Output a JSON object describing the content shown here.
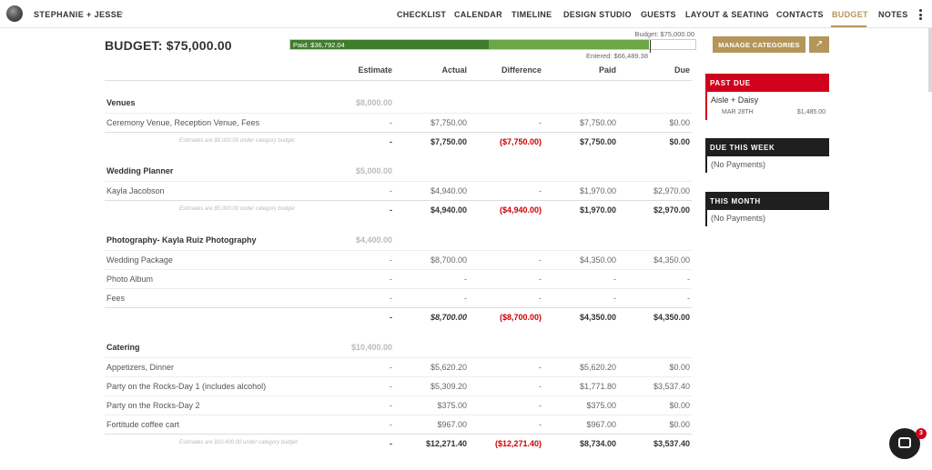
{
  "header": {
    "couple_name": "STEPHANIE + JESSE",
    "nav": [
      {
        "label": "CHECKLIST"
      },
      {
        "label": "CALENDAR"
      },
      {
        "label": "TIMELINE"
      },
      {
        "label": "DESIGN STUDIO"
      },
      {
        "label": "GUESTS"
      },
      {
        "label": "LAYOUT & SEATING"
      },
      {
        "label": "CONTACTS"
      },
      {
        "label": "BUDGET"
      },
      {
        "label": "NOTES"
      }
    ],
    "active_nav": "BUDGET",
    "accent_color": "#b4965a"
  },
  "budget": {
    "title": "BUDGET:",
    "amount": "$75,000.00",
    "bar_budget_label": "Budget: $75,000.00",
    "bar_paid_label": "Paid: $36,792.04",
    "bar_entered_label": "Entered: $66,489.38",
    "paid_fraction": 0.4906,
    "entered_fraction": 0.8865,
    "paid_color": "#3f7d2a",
    "entered_color": "#6ca647"
  },
  "toolbar": {
    "manage_label": "MANAGE CATEGORIES",
    "export_icon": "export-icon"
  },
  "table": {
    "columns": [
      "Estimate",
      "Actual",
      "Difference",
      "Paid",
      "Due"
    ],
    "categories": [
      {
        "name": "Venues",
        "estimate": "$8,000.00",
        "items": [
          {
            "name": "Ceremony Venue, Reception Venue, Fees",
            "estimate": "-",
            "actual": "$7,750.00",
            "difference": "-",
            "paid": "$7,750.00",
            "due": "$0.00"
          }
        ],
        "total": {
          "note": "Estimates are $8,000.00 under category budget",
          "estimate": "-",
          "actual": "$7,750.00",
          "difference": "($7,750.00)",
          "paid": "$7,750.00",
          "due": "$0.00"
        }
      },
      {
        "name": "Wedding Planner",
        "estimate": "$5,000.00",
        "items": [
          {
            "name": "Kayla Jacobson",
            "estimate": "-",
            "actual": "$4,940.00",
            "difference": "-",
            "paid": "$1,970.00",
            "due": "$2,970.00"
          }
        ],
        "total": {
          "note": "Estimates are $5,000.00 under category budget",
          "estimate": "-",
          "actual": "$4,940.00",
          "difference": "($4,940.00)",
          "paid": "$1,970.00",
          "due": "$2,970.00"
        }
      },
      {
        "name": "Photography- Kayla Ruiz Photography",
        "estimate": "$4,400.00",
        "items": [
          {
            "name": "Wedding Package",
            "estimate": "-",
            "actual": "$8,700.00",
            "difference": "-",
            "paid": "$4,350.00",
            "due": "$4,350.00"
          },
          {
            "name": "Photo Album",
            "estimate": "-",
            "actual": "-",
            "difference": "-",
            "paid": "-",
            "due": "-"
          },
          {
            "name": "Fees",
            "estimate": "-",
            "actual": "-",
            "difference": "-",
            "paid": "-",
            "due": "-"
          }
        ],
        "total": {
          "note": "",
          "estimate": "-",
          "actual": "$8,700.00",
          "difference": "($8,700.00)",
          "paid": "$4,350.00",
          "due": "$4,350.00"
        }
      },
      {
        "name": "Catering",
        "estimate": "$10,400.00",
        "items": [
          {
            "name": "Appetizers, Dinner",
            "estimate": "-",
            "actual": "$5,620.20",
            "difference": "-",
            "paid": "$5,620.20",
            "due": "$0.00"
          },
          {
            "name": "Party on the Rocks-Day 1 (includes alcohol)",
            "estimate": "-",
            "actual": "$5,309.20",
            "difference": "-",
            "paid": "$1,771.80",
            "due": "$3,537.40"
          },
          {
            "name": "Party on the Rocks-Day 2",
            "estimate": "-",
            "actual": "$375.00",
            "difference": "-",
            "paid": "$375.00",
            "due": "$0.00"
          },
          {
            "name": "Fortitude coffee cart",
            "estimate": "-",
            "actual": "$967.00",
            "difference": "-",
            "paid": "$967.00",
            "due": "$0.00"
          }
        ],
        "total": {
          "note": "Estimates are $10,400.00 under category budget",
          "estimate": "-",
          "actual": "$12,271.40",
          "difference": "($12,271.40)",
          "paid": "$8,734.00",
          "due": "$3,537.40"
        }
      }
    ]
  },
  "sidebar": {
    "past_due": {
      "title": "PAST DUE",
      "vendor": "Aisle + Daisy",
      "date": "MAR 28TH",
      "amount": "$1,485.00"
    },
    "due_this_week": {
      "title": "DUE THIS WEEK",
      "text": "(No Payments)"
    },
    "this_month": {
      "title": "THIS MONTH",
      "text": "(No Payments)"
    },
    "past_due_color": "#d0021b"
  },
  "chat": {
    "badge": "3"
  }
}
